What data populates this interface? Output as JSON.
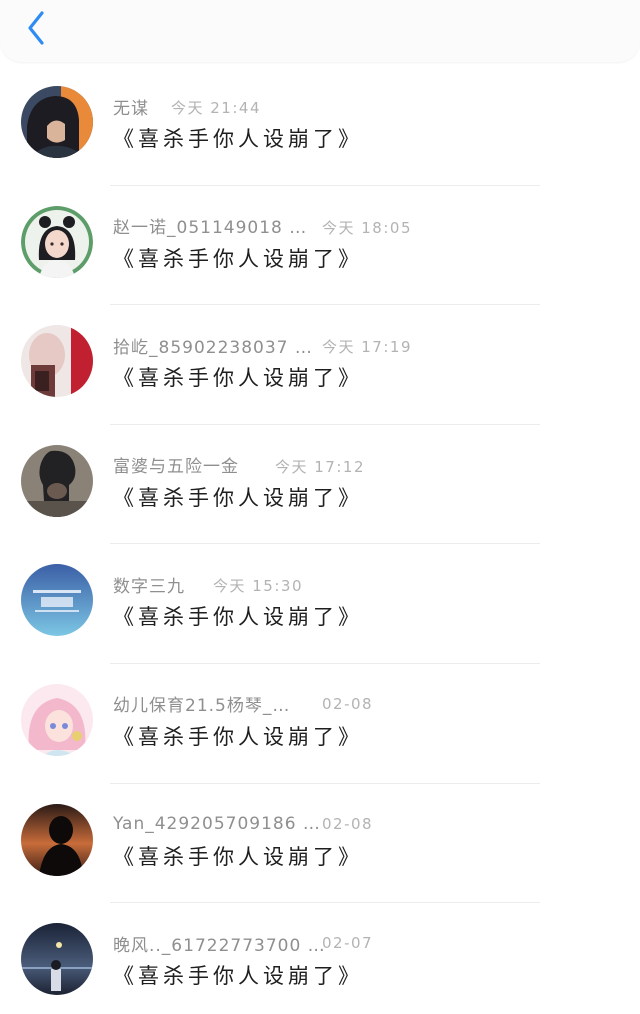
{
  "header": {
    "back_icon": "chevron-left-icon",
    "accent_color": "#2f8cf4"
  },
  "comments": [
    {
      "name": "无谋",
      "time": "今天 21:44",
      "text": "《喜杀手你人设崩了》",
      "avatar_icon": "dark-hair-boy-avatar"
    },
    {
      "name": "赵一诺_051149018 …",
      "time": "今天 18:05",
      "text": "《喜杀手你人设崩了》",
      "avatar_icon": "anime-girl-avatar"
    },
    {
      "name": "拾屹_85902238037 …",
      "time": "今天 17:19",
      "text": "《喜杀手你人设崩了》",
      "avatar_icon": "blurred-photo-avatar"
    },
    {
      "name": "富婆与五险一金",
      "time": "今天 17:12",
      "text": "《喜杀手你人设崩了》",
      "avatar_icon": "dark-portrait-avatar"
    },
    {
      "name": "数字三九",
      "time": "今天 15:30",
      "text": "《喜杀手你人设崩了》",
      "avatar_icon": "blue-text-avatar"
    },
    {
      "name": "幼儿保育21.5杨琴_…",
      "time": "02-08",
      "text": "《喜杀手你人设崩了》",
      "avatar_icon": "pink-anime-avatar"
    },
    {
      "name": "Yan_429205709186 …",
      "time": "02-08",
      "text": "《喜杀手你人设崩了》",
      "avatar_icon": "sunset-silhouette-avatar"
    },
    {
      "name": "晚风.._61722773700 …",
      "time": "02-07",
      "text": "《喜杀手你人设崩了》",
      "avatar_icon": "night-sea-avatar"
    }
  ]
}
